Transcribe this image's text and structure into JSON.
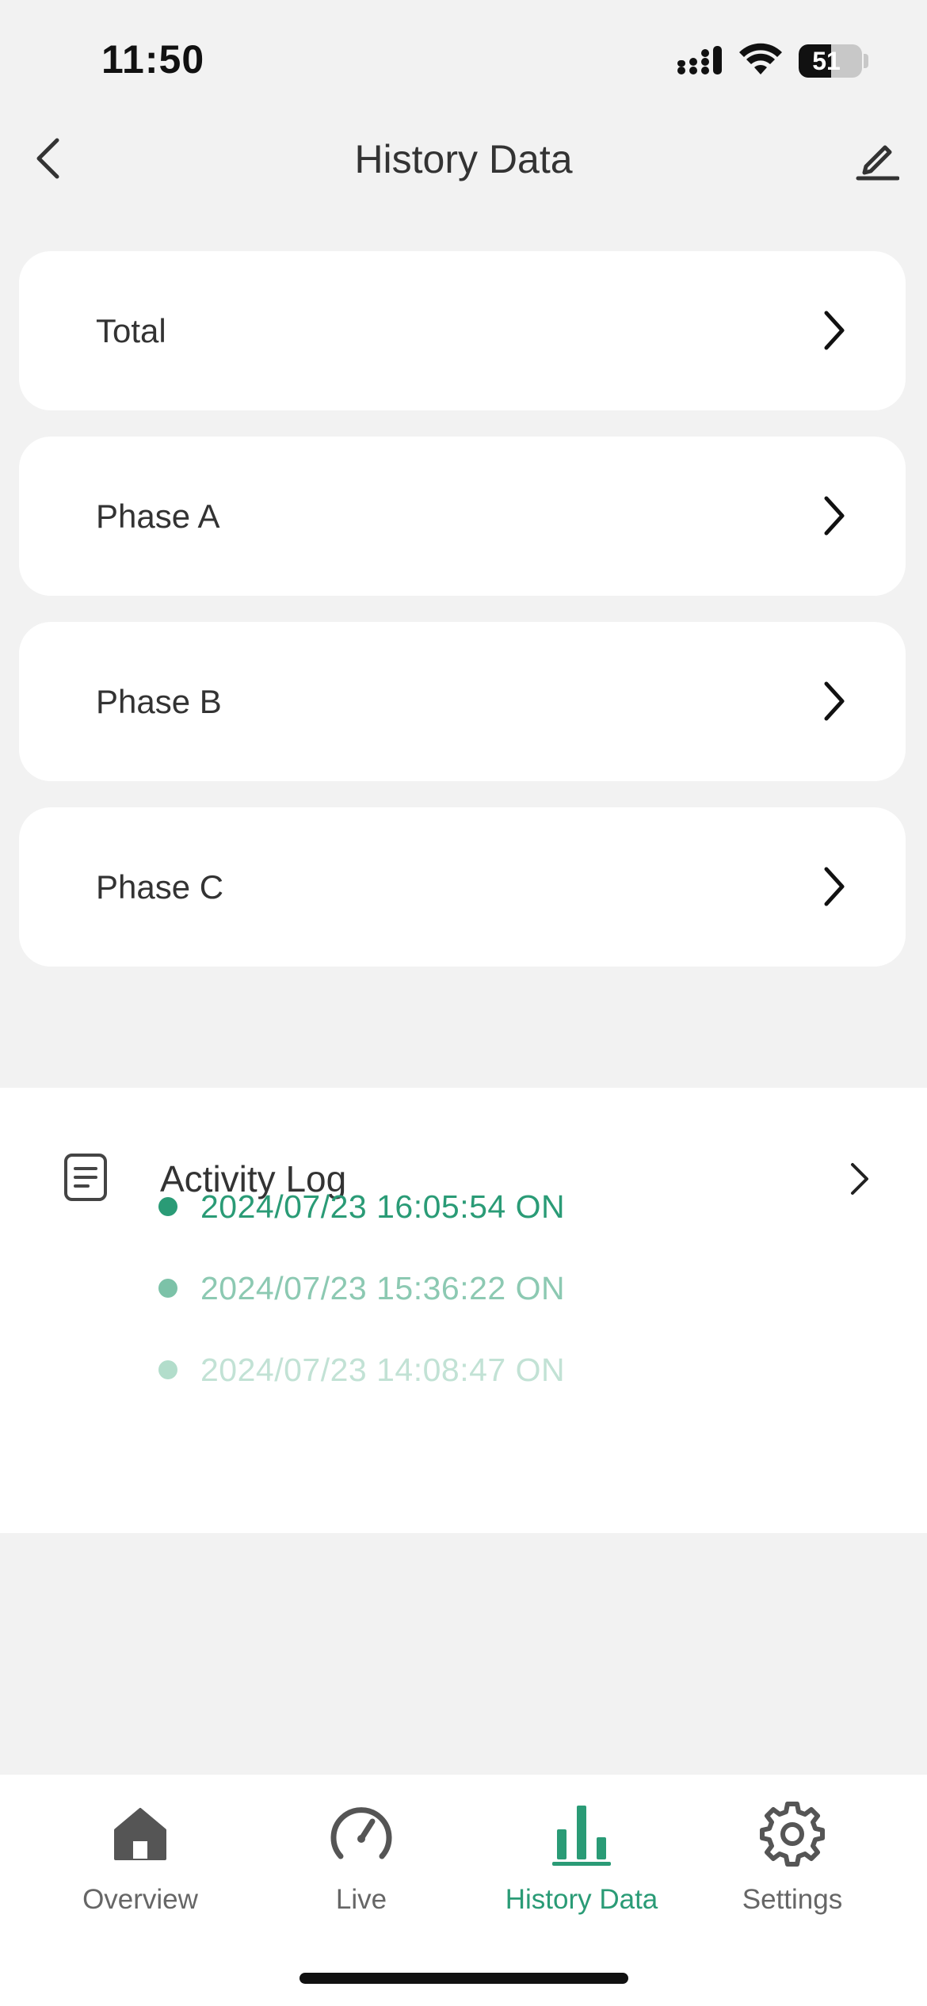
{
  "status_bar": {
    "time": "11:50",
    "battery": "51",
    "battery_level": 0.51
  },
  "header": {
    "title": "History Data"
  },
  "cards": [
    {
      "label": "Total"
    },
    {
      "label": "Phase A"
    },
    {
      "label": "Phase B"
    },
    {
      "label": "Phase C"
    }
  ],
  "activity_log": {
    "title": "Activity Log",
    "entries": [
      {
        "text": "2024/07/23 16:05:54 ON",
        "color": "#2a9b76",
        "dot_color": "#2a9b76"
      },
      {
        "text": "2024/07/23 15:36:22 ON",
        "color": "#8cc9b2",
        "dot_color": "#7cc2a8"
      },
      {
        "text": "2024/07/23 14:08:47 ON",
        "color": "#c2e2d5",
        "dot_color": "#b2ddcb"
      }
    ]
  },
  "tabs": [
    {
      "label": "Overview",
      "icon": "home-icon",
      "active": false
    },
    {
      "label": "Live",
      "icon": "speedometer-icon",
      "active": false
    },
    {
      "label": "History Data",
      "icon": "bar-chart-icon",
      "active": true
    },
    {
      "label": "Settings",
      "icon": "gear-icon",
      "active": false
    }
  ],
  "colors": {
    "accent": "#2a9b76",
    "background": "#f2f2f2",
    "card": "#ffffff",
    "text": "#333333"
  }
}
